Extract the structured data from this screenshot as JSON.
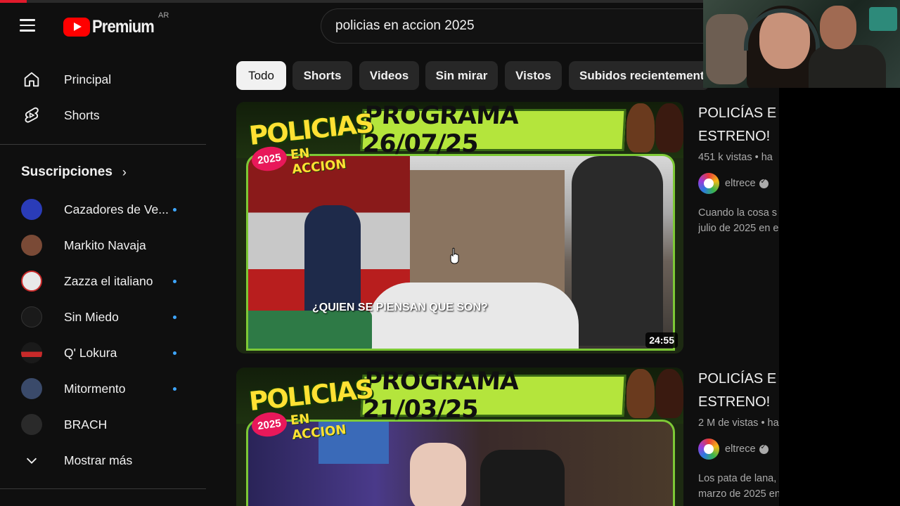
{
  "header": {
    "logo_text": "Premium",
    "country": "AR",
    "search_value": "policias en accion 2025"
  },
  "sidebar": {
    "main": [
      {
        "label": "Principal",
        "icon": "home-icon"
      },
      {
        "label": "Shorts",
        "icon": "shorts-icon"
      }
    ],
    "subscriptions_title": "Suscripciones",
    "subscriptions": [
      {
        "label": "Cazadores de Ve...",
        "new": true,
        "color": "#2a3cb8"
      },
      {
        "label": "Markito Navaja",
        "new": false,
        "color": "#7a4a36"
      },
      {
        "label": "Zazza el italiano",
        "new": true,
        "color": "#e8e8e8"
      },
      {
        "label": "Sin Miedo",
        "new": true,
        "color": "#1a1a1a"
      },
      {
        "label": "Q' Lokura",
        "new": true,
        "color": "#c82a2a"
      },
      {
        "label": "Mitormento",
        "new": true,
        "color": "#3a4a6a"
      },
      {
        "label": "BRACH",
        "new": false,
        "color": "#2a2a2a"
      }
    ],
    "show_more": "Mostrar más"
  },
  "chips": [
    "Todo",
    "Shorts",
    "Videos",
    "Sin mirar",
    "Vistos",
    "Subidos recientemente"
  ],
  "videos": [
    {
      "brand_top": "POLICIAS",
      "brand_sub": "EN ACCION",
      "brand_year": "2025",
      "program": "PROGRAMA 26/07/25",
      "caption": "¿QUIEN SE PIENSAN QUE SON?",
      "duration": "24:55",
      "title_line1": "POLICÍAS E",
      "title_line2": "ESTRENO!",
      "stats": "451 k vistas • ha",
      "channel": "eltrece",
      "desc_line1": "Cuando la cosa s",
      "desc_line2": "julio de 2025 en e"
    },
    {
      "brand_top": "POLICIAS",
      "brand_sub": "EN ACCION",
      "brand_year": "2025",
      "program": "PROGRAMA 21/03/25",
      "caption": "",
      "duration": "",
      "title_line1": "POLICÍAS E",
      "title_line2": "ESTRENO!",
      "stats": "2 M de vistas • ha",
      "channel": "eltrece",
      "desc_line1": "Los pata de lana,",
      "desc_line2": "marzo de 2025 en"
    }
  ],
  "colors": {
    "accent_red": "#ff0000",
    "thumb_green": "#b4e53c",
    "new_dot": "#3ea6ff"
  }
}
